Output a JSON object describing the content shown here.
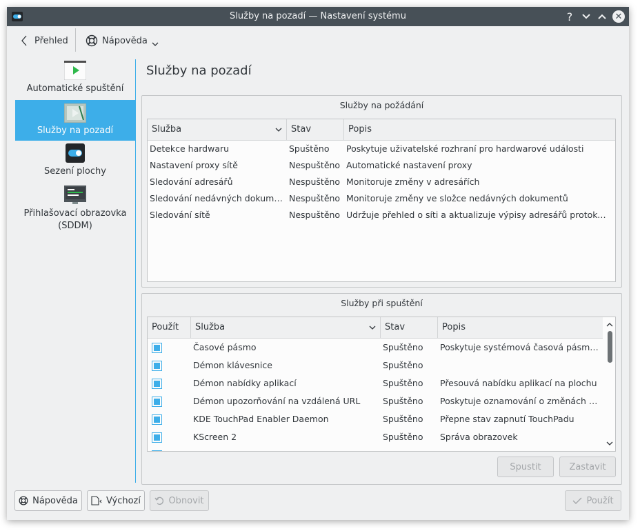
{
  "window": {
    "title": "Služby na pozadí  — Nastavení systému"
  },
  "toolbar": {
    "back_label": "Přehled",
    "help_label": "Nápověda"
  },
  "sidebar": {
    "items": [
      {
        "label": "Automatické spuštění",
        "icon": "autostart-icon"
      },
      {
        "label": "Služby na pozadí",
        "icon": "background-services-icon"
      },
      {
        "label": "Sezení plochy",
        "icon": "desktop-session-icon"
      },
      {
        "label": "Přihlašovací obrazovka (SDDM)",
        "icon": "login-screen-icon"
      }
    ]
  },
  "page_title": "Služby na pozadí",
  "on_demand": {
    "title": "Služby na požádání",
    "columns": [
      "Služba",
      "Stav",
      "Popis"
    ],
    "rows": [
      [
        "Detekce hardwaru",
        "Spuštěno",
        "Poskytuje uživatelské rozhraní pro hardwarové události"
      ],
      [
        "Nastavení proxy sítě",
        "Nespuštěno",
        "Automatické nastavení proxy"
      ],
      [
        "Sledování adresářů",
        "Nespuštěno",
        "Monitoruje změny v adresářích"
      ],
      [
        "Sledování nedávných dokumentů",
        "Nespuštěno",
        "Monitoruje změny ve složce nedávných dokumentů"
      ],
      [
        "Sledování sítě",
        "Nespuštěno",
        "Udržuje přehled o síti a aktualizuje výpisy adresářů protokolu net..."
      ]
    ]
  },
  "startup": {
    "title": "Služby při spuštění",
    "columns": [
      "Použít",
      "Služba",
      "Stav",
      "Popis"
    ],
    "rows": [
      [
        "Časové pásmo",
        "Spuštěno",
        "Poskytuje systémová časová pásma ap..."
      ],
      [
        "Démon klávesnice",
        "Spuštěno",
        ""
      ],
      [
        "Démon nabídky aplikací",
        "Spuštěno",
        "Přesouvá nabídku aplikací na plochu"
      ],
      [
        "Démon upozorňování na vzdálená URL",
        "Spuštěno",
        "Poskytuje oznamování o změnách síťov..."
      ],
      [
        "KDE TouchPad Enabler Daemon",
        "Spuštěno",
        "Přepne stav zapnutí TouchPadu"
      ],
      [
        "KScreen 2",
        "Spuštěno",
        "Správa obrazovek"
      ]
    ],
    "start_label": "Spustit",
    "stop_label": "Zastavit"
  },
  "footer": {
    "help_label": "Nápověda",
    "defaults_label": "Výchozí",
    "reset_label": "Obnovit",
    "apply_label": "Použít"
  },
  "colors": {
    "accent": "#3daee9",
    "titlebar": "#475057",
    "window_bg": "#eff0f1"
  }
}
